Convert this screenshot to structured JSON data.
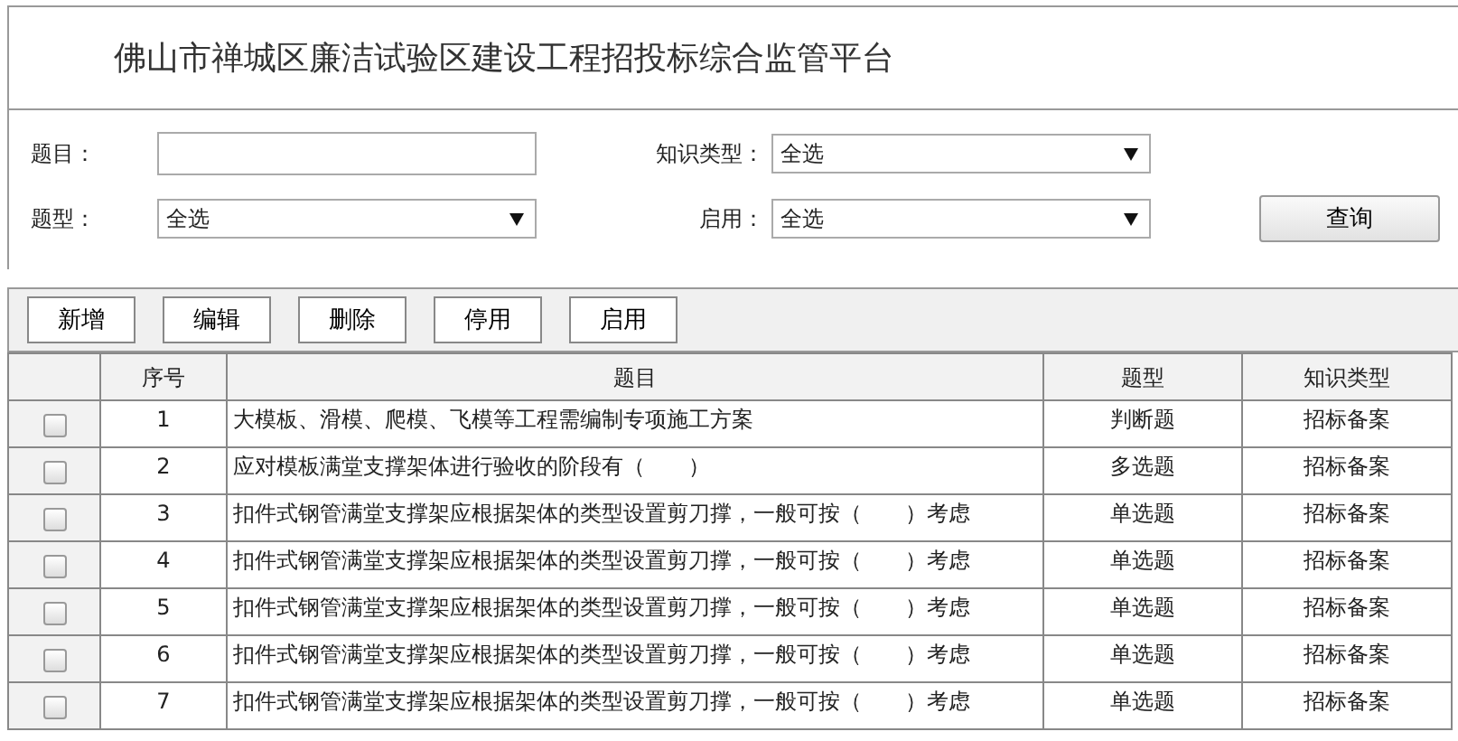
{
  "header": {
    "title": "佛山市禅城区廉洁试验区建设工程招投标综合监管平台"
  },
  "filters": {
    "question": {
      "label": "题目："
    },
    "knowledge_type": {
      "label": "知识类型：",
      "value": "全选"
    },
    "question_type": {
      "label": "题型：",
      "value": "全选"
    },
    "enabled": {
      "label": "启用：",
      "value": "全选"
    },
    "search_button": "查询"
  },
  "toolbar": [
    "新增",
    "编辑",
    "删除",
    "停用",
    "启用"
  ],
  "table": {
    "columns": [
      "序号",
      "题目",
      "题型",
      "知识类型"
    ],
    "rows": [
      {
        "checked": false,
        "cells": [
          "1",
          "大模板、滑模、爬模、飞模等工程需编制专项施工方案",
          "判断题",
          "招标备案"
        ]
      },
      {
        "checked": false,
        "cells": [
          "2",
          "应对模板满堂支撑架体进行验收的阶段有（　　）",
          "多选题",
          "招标备案"
        ]
      },
      {
        "checked": false,
        "cells": [
          "3",
          "扣件式钢管满堂支撑架应根据架体的类型设置剪刀撑，一般可按（　　）考虑",
          "单选题",
          "招标备案"
        ]
      },
      {
        "checked": false,
        "cells": [
          "4",
          "扣件式钢管满堂支撑架应根据架体的类型设置剪刀撑，一般可按（　　）考虑",
          "单选题",
          "招标备案"
        ]
      },
      {
        "checked": false,
        "cells": [
          "5",
          "扣件式钢管满堂支撑架应根据架体的类型设置剪刀撑，一般可按（　　）考虑",
          "单选题",
          "招标备案"
        ]
      },
      {
        "checked": false,
        "cells": [
          "6",
          "扣件式钢管满堂支撑架应根据架体的类型设置剪刀撑，一般可按（　　）考虑",
          "单选题",
          "招标备案"
        ]
      },
      {
        "checked": false,
        "cells": [
          "7",
          "扣件式钢管满堂支撑架应根据架体的类型设置剪刀撑，一般可按（　　）考虑",
          "单选题",
          "招标备案"
        ]
      }
    ]
  }
}
